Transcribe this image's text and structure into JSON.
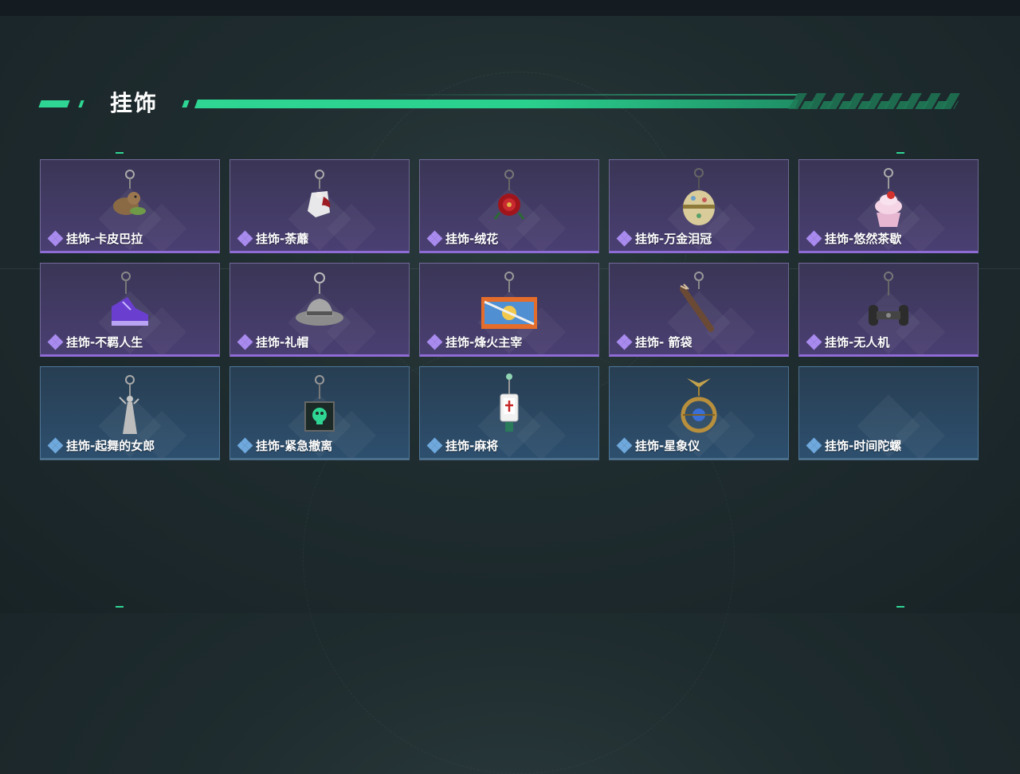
{
  "page": {
    "title": "挂饰"
  },
  "colors": {
    "accent": "#2fd693",
    "purple_rarity": "#8f6bd6",
    "blue_rarity": "#4f96d3"
  },
  "items": [
    {
      "label": "挂饰-卡皮巴拉",
      "rarity": "purple",
      "icon": "capybara-charm-icon"
    },
    {
      "label": "挂饰-荼蘼",
      "rarity": "purple",
      "icon": "flower-doll-charm-icon"
    },
    {
      "label": "挂饰-绒花",
      "rarity": "purple",
      "icon": "red-flower-charm-icon"
    },
    {
      "label": "挂饰-万金泪冠",
      "rarity": "purple",
      "icon": "jeweled-egg-charm-icon"
    },
    {
      "label": "挂饰-悠然茶歇",
      "rarity": "purple",
      "icon": "cupcake-charm-icon"
    },
    {
      "label": "挂饰-不羁人生",
      "rarity": "purple",
      "icon": "sneaker-charm-icon"
    },
    {
      "label": "挂饰-礼帽",
      "rarity": "purple",
      "icon": "fedora-hat-charm-icon"
    },
    {
      "label": "挂饰-烽火主宰",
      "rarity": "purple",
      "icon": "container-charm-icon"
    },
    {
      "label": "挂饰- 箭袋",
      "rarity": "purple",
      "icon": "quiver-charm-icon"
    },
    {
      "label": "挂饰-无人机",
      "rarity": "purple",
      "icon": "drone-wheels-charm-icon"
    },
    {
      "label": "挂饰-起舞的女郎",
      "rarity": "blue",
      "icon": "dancer-figurine-charm-icon"
    },
    {
      "label": "挂饰-紧急撤离",
      "rarity": "blue",
      "icon": "skull-box-charm-icon"
    },
    {
      "label": "挂饰-麻将",
      "rarity": "blue",
      "icon": "mahjong-tile-charm-icon"
    },
    {
      "label": "挂饰-星象仪",
      "rarity": "blue",
      "icon": "astrolabe-charm-icon"
    },
    {
      "label": "挂饰-时间陀螺",
      "rarity": "blue",
      "icon": "spinning-top-charm-icon"
    }
  ]
}
